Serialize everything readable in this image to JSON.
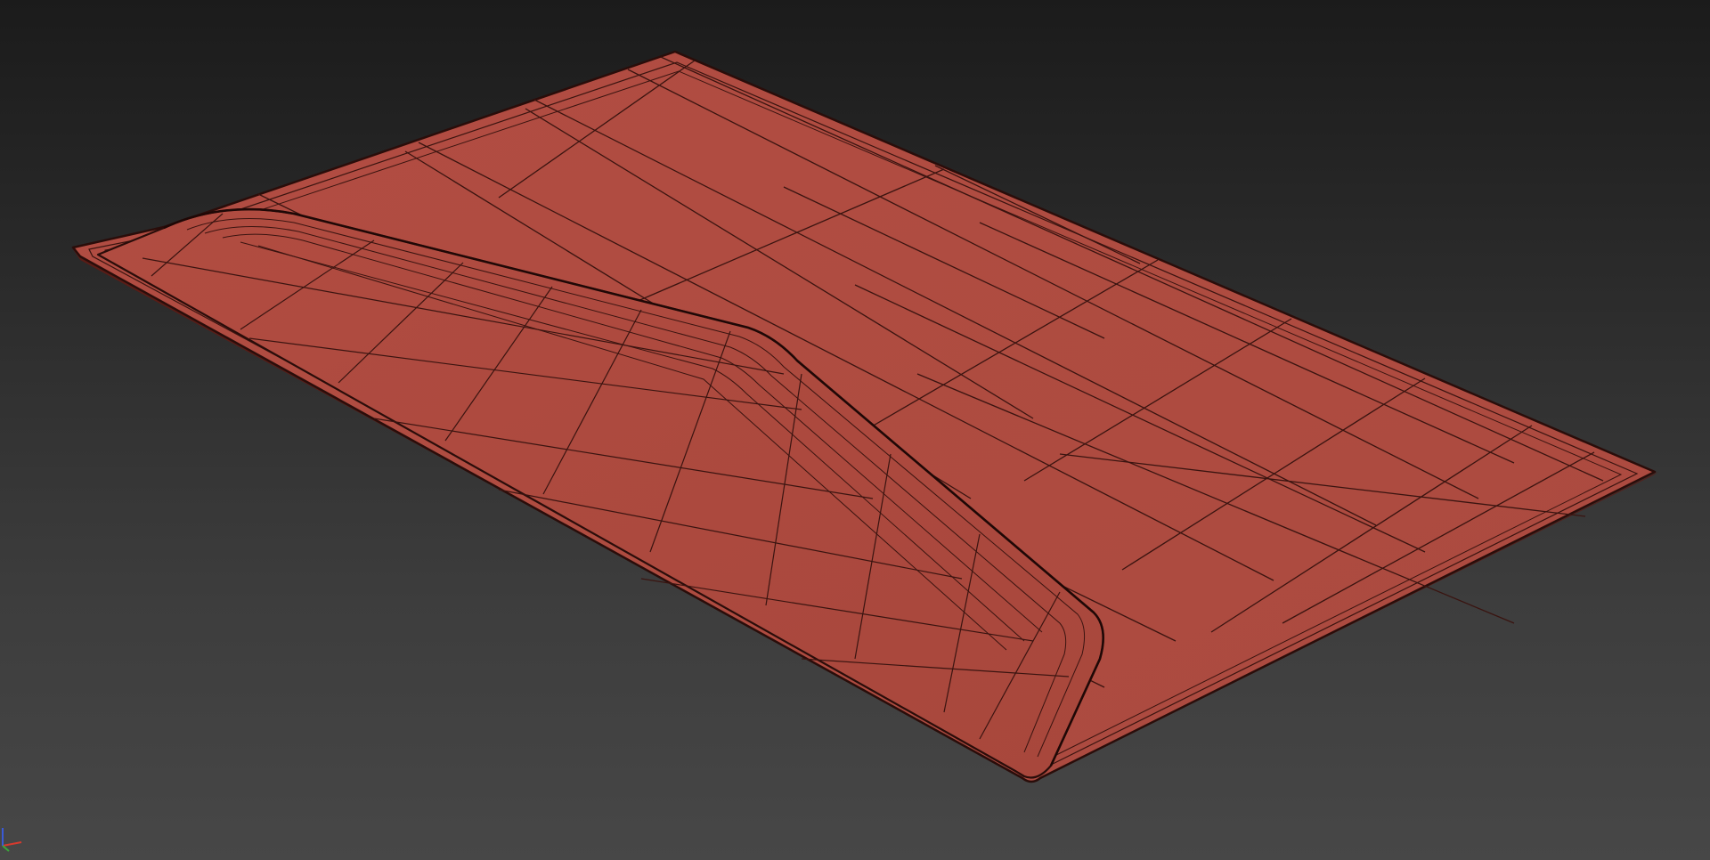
{
  "viewport": {
    "background_top": "#1b1b1b",
    "background_bottom": "#474747"
  },
  "model": {
    "shading": "wireframe-on-shaded",
    "fill_color": "#b04b40",
    "edge_color": "#3a1410"
  },
  "axis_gizmo": {
    "icon": "xyz-axis-tripod-icon",
    "x_color": "#d63a2e",
    "y_color": "#3aa83a",
    "z_color": "#3a5ad6"
  }
}
